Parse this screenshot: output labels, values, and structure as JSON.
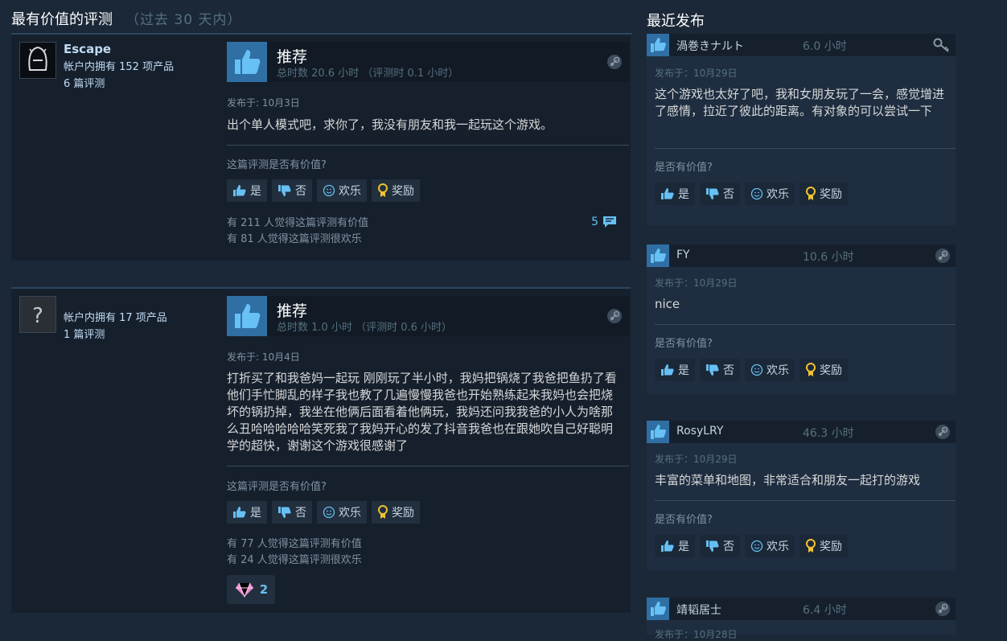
{
  "left": {
    "title": "最有价值的评测",
    "subtitle": "（过去 30 天内）"
  },
  "right": {
    "title": "最近发布"
  },
  "vote_labels": {
    "question": "这篇评测是否有价值?",
    "short_question": "是否有价值?",
    "yes": "是",
    "no": "否",
    "funny": "欢乐",
    "award": "奖励"
  },
  "reviews": [
    {
      "author": "Escape",
      "products": "帐户内拥有 152 项产品",
      "review_count": "6 篇评测",
      "recommend": "推荐",
      "hours": "总时数 20.6 小时 （评测时 0.1 小时）",
      "posted": "发布于: 10月3日",
      "text": "出个单人模式吧，求你了，我没有朋友和我一起玩这个游戏。",
      "helpful": "有 211 人觉得这篇评测有价值",
      "funny": "有 81 人觉得这篇评测很欢乐",
      "comments": "5"
    },
    {
      "author": "",
      "products": "帐户内拥有 17 项产品",
      "review_count": "1 篇评测",
      "recommend": "推荐",
      "hours": "总时数 1.0 小时 （评测时 0.6 小时）",
      "posted": "发布于: 10月4日",
      "text": "打折买了和我爸妈一起玩 刚刚玩了半小时，我妈把锅烧了我爸把鱼扔了看他们手忙脚乱的样子我也教了几遍慢慢我爸也开始熟练起来我妈也会把烧坏的锅扔掉，我坐在他俩后面看着他俩玩，我妈还问我我爸的小人为啥那么丑哈哈哈哈哈笑死我了我妈开心的发了抖音我爸也在跟她吹自己好聪明学的超快，谢谢这个游戏很感谢了",
      "helpful": "有 77 人觉得这篇评测有价值",
      "funny": "有 24 人觉得这篇评测很欢乐",
      "awards": "2"
    }
  ],
  "recent": [
    {
      "name": "渦巻きナルト",
      "hours": "6.0 小时",
      "posted": "发布于：10月29日",
      "text": "这个游戏也太好了吧，我和女朋友玩了一会，感觉增进了感情，拉近了彼此的距离。有对象的可以尝试一下"
    },
    {
      "name": "FY",
      "hours": "10.6 小时",
      "posted": "发布于：10月29日",
      "text": "nice"
    },
    {
      "name": "RosyLRY",
      "hours": "46.3 小时",
      "posted": "发布于：10月29日",
      "text": "丰富的菜单和地图，非常适合和朋友一起打的游戏"
    },
    {
      "name": "靖韬居士",
      "hours": "6.4 小时",
      "posted": "发布于：10月28日",
      "text": ""
    }
  ]
}
